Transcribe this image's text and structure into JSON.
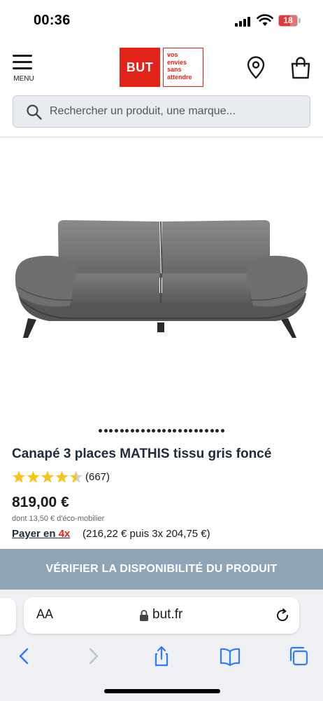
{
  "status": {
    "time": "00:36",
    "battery": "18"
  },
  "header": {
    "menu_label": "MENU",
    "logo_main": "BUT",
    "logo_tagline": [
      "vos",
      "envies",
      "sans",
      "attendre"
    ]
  },
  "search": {
    "placeholder": "Rechercher un produit, une marque..."
  },
  "carousel": {
    "dot_count": 24
  },
  "product": {
    "title": "Canapé 3 places MATHIS tissu gris foncé",
    "rating": 4.5,
    "reviews": "(667)",
    "price": "819,00 €",
    "eco": "dont 13,50 € d'éco-mobilier",
    "payer_label": "Payer en",
    "payer_x": "4x",
    "installments": "(216,22 € puis 3x 204,75 €)"
  },
  "cta": {
    "availability": "VÉRIFIER LA DISPONIBILITÉ DU PRODUIT"
  },
  "browser": {
    "aa_label": "AA",
    "url": "but.fr"
  },
  "colors": {
    "brand_red": "#e2231a",
    "cta_bg": "#8ea4b7",
    "star": "#f5c518",
    "safari_blue": "#2f7cf6"
  }
}
